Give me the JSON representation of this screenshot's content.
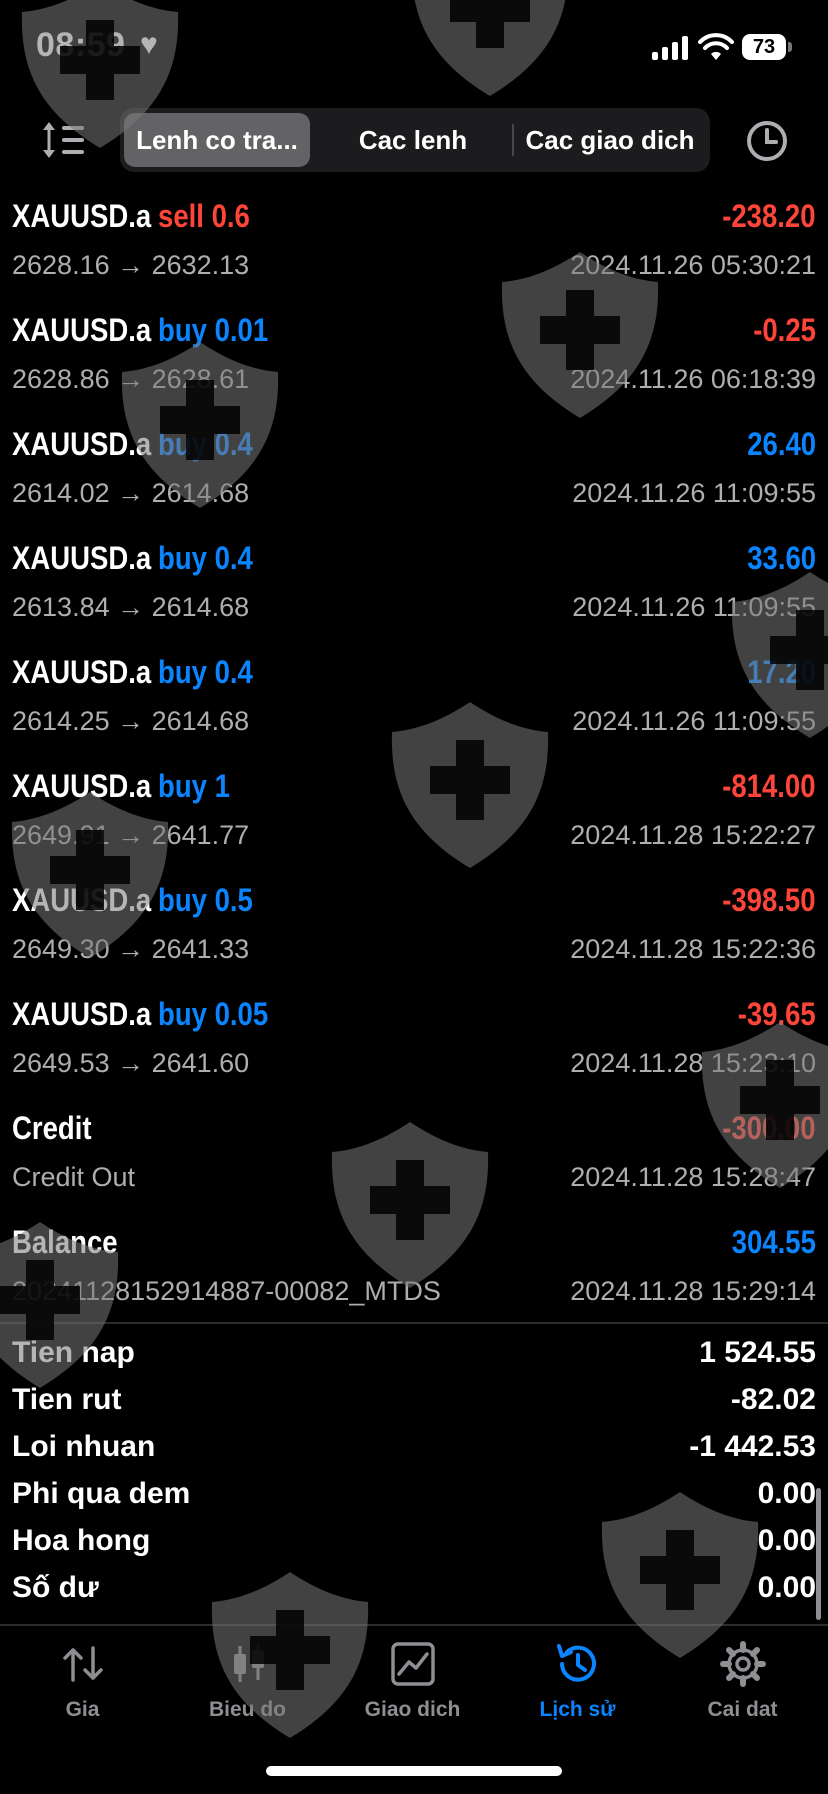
{
  "status_bar": {
    "time": "08:59",
    "battery": "73"
  },
  "toolbar": {
    "segments": [
      "Lenh co tra...",
      "Cac lenh",
      "Cac giao dich"
    ],
    "active_segment": 0
  },
  "trades": [
    {
      "symbol": "XAUUSD.a",
      "side": "sell 0.6",
      "side_color": "#ff453a",
      "prices": "2628.16 → 2632.13",
      "profit": "-238.20",
      "profit_color": "#ff453a",
      "datetime": "2024.11.26 05:30:21"
    },
    {
      "symbol": "XAUUSD.a",
      "side": "buy 0.01",
      "side_color": "#0a84ff",
      "prices": "2628.86 → 2628.61",
      "profit": "-0.25",
      "profit_color": "#ff453a",
      "datetime": "2024.11.26 06:18:39"
    },
    {
      "symbol": "XAUUSD.a",
      "side": "buy 0.4",
      "side_color": "#0a84ff",
      "prices": "2614.02 → 2614.68",
      "profit": "26.40",
      "profit_color": "#0a84ff",
      "datetime": "2024.11.26 11:09:55"
    },
    {
      "symbol": "XAUUSD.a",
      "side": "buy 0.4",
      "side_color": "#0a84ff",
      "prices": "2613.84 → 2614.68",
      "profit": "33.60",
      "profit_color": "#0a84ff",
      "datetime": "2024.11.26 11:09:55"
    },
    {
      "symbol": "XAUUSD.a",
      "side": "buy 0.4",
      "side_color": "#0a84ff",
      "prices": "2614.25 → 2614.68",
      "profit": "17.20",
      "profit_color": "#0a84ff",
      "datetime": "2024.11.26 11:09:55"
    },
    {
      "symbol": "XAUUSD.a",
      "side": "buy 1",
      "side_color": "#0a84ff",
      "prices": "2649.91 → 2641.77",
      "profit": "-814.00",
      "profit_color": "#ff453a",
      "datetime": "2024.11.28 15:22:27"
    },
    {
      "symbol": "XAUUSD.a",
      "side": "buy 0.5",
      "side_color": "#0a84ff",
      "prices": "2649.30 → 2641.33",
      "profit": "-398.50",
      "profit_color": "#ff453a",
      "datetime": "2024.11.28 15:22:36"
    },
    {
      "symbol": "XAUUSD.a",
      "side": "buy 0.05",
      "side_color": "#0a84ff",
      "prices": "2649.53 → 2641.60",
      "profit": "-39.65",
      "profit_color": "#ff453a",
      "datetime": "2024.11.28 15:23:10"
    },
    {
      "symbol": "Credit",
      "side": "",
      "side_color": "#ffffff",
      "prices": "Credit Out",
      "profit": "-300.00",
      "profit_color": "#ff453a",
      "datetime": "2024.11.28 15:28:47"
    },
    {
      "symbol": "Balance",
      "side": "",
      "side_color": "#ffffff",
      "prices": "20241128152914887-00082_MTDS",
      "profit": "304.55",
      "profit_color": "#0a84ff",
      "datetime": "2024.11.28 15:29:14"
    }
  ],
  "summary": [
    {
      "label": "Tien nap",
      "value": "1 524.55"
    },
    {
      "label": "Tien rut",
      "value": "-82.02"
    },
    {
      "label": "Loi nhuan",
      "value": "-1 442.53"
    },
    {
      "label": "Phi qua dem",
      "value": "0.00"
    },
    {
      "label": "Hoa hong",
      "value": "0.00"
    },
    {
      "label": "Số dư",
      "value": "0.00"
    }
  ],
  "tabbar": {
    "items": [
      {
        "label": "Gia",
        "icon": "arrows-up-down-icon"
      },
      {
        "label": "Bieu do",
        "icon": "candlestick-icon"
      },
      {
        "label": "Giao dich",
        "icon": "chart-line-icon"
      },
      {
        "label": "Lịch sử",
        "icon": "history-clock-icon"
      },
      {
        "label": "Cai dat",
        "icon": "gear-icon"
      }
    ],
    "active": 3
  },
  "colors": {
    "loss": "#ff453a",
    "gain": "#0a84ff",
    "background": "#000000"
  }
}
